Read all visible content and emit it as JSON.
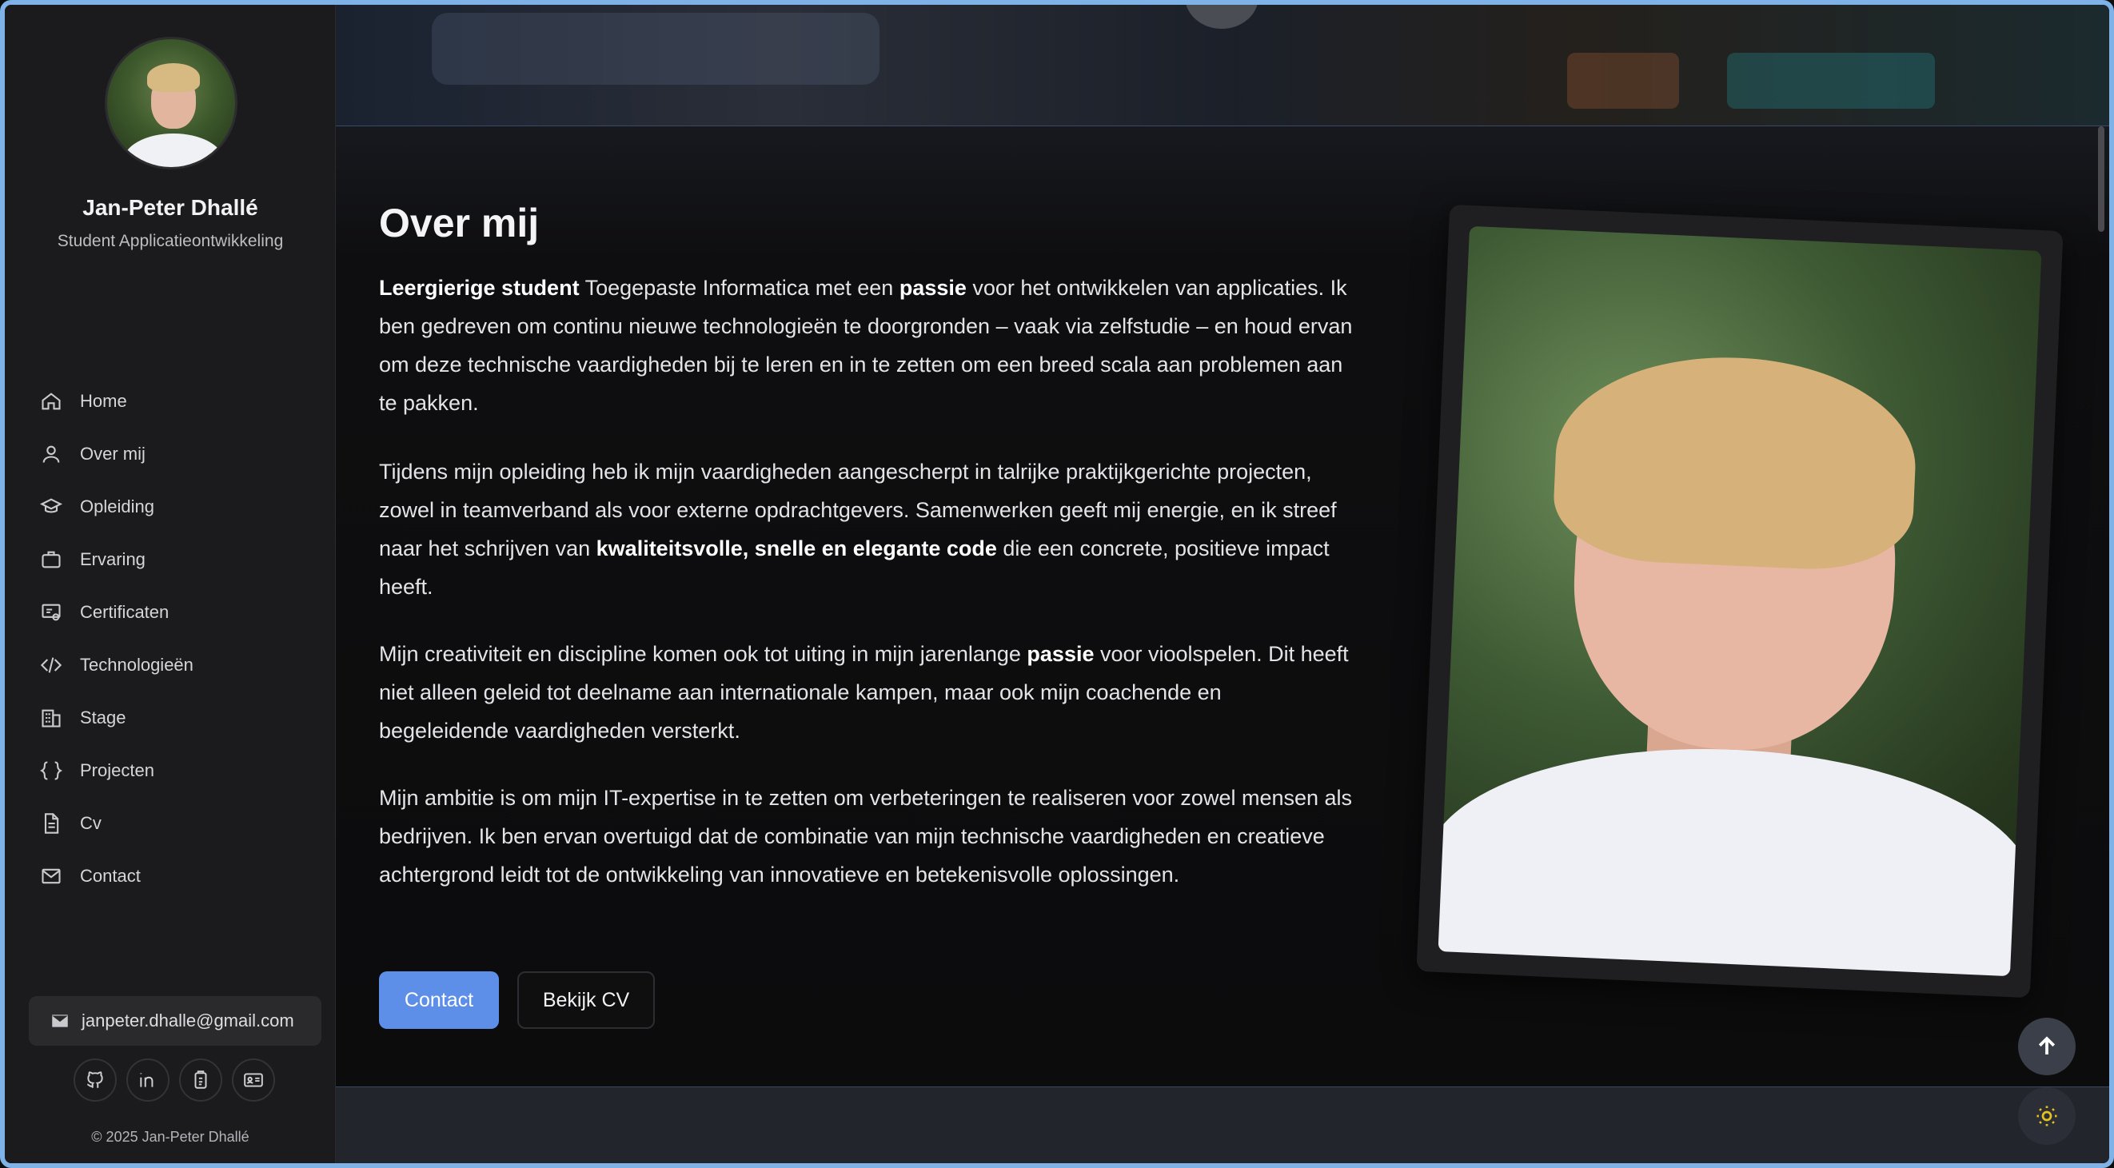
{
  "sidebar": {
    "name": "Jan-Peter Dhallé",
    "role": "Student Applicatieontwikkeling",
    "nav": [
      {
        "label": "Home",
        "icon": "home-icon"
      },
      {
        "label": "Over mij",
        "icon": "user-icon"
      },
      {
        "label": "Opleiding",
        "icon": "graduation-cap-icon"
      },
      {
        "label": "Ervaring",
        "icon": "briefcase-icon"
      },
      {
        "label": "Certificaten",
        "icon": "certificate-icon"
      },
      {
        "label": "Technologieën",
        "icon": "code-icon"
      },
      {
        "label": "Stage",
        "icon": "building-icon"
      },
      {
        "label": "Projecten",
        "icon": "braces-icon"
      },
      {
        "label": "Cv",
        "icon": "document-icon"
      },
      {
        "label": "Contact",
        "icon": "mail-icon"
      }
    ],
    "email": "janpeter.dhalle@gmail.com",
    "socials": [
      "github-icon",
      "linkedin-icon",
      "clipboard-badge-icon",
      "id-card-icon"
    ],
    "copyright": "© 2025 Jan-Peter Dhallé"
  },
  "main": {
    "title": "Over mij",
    "p1": {
      "b1": "Leergierige student",
      "t1": " Toegepaste Informatica met een ",
      "b2": "passie",
      "t2": " voor het ontwikkelen van applicaties. Ik ben gedreven om continu nieuwe technologieën te doorgronden – vaak via zelfstudie – en houd ervan om deze technische vaardigheden bij te leren en in te zetten om een breed scala aan problemen aan te pakken."
    },
    "p2": {
      "t1": "Tijdens mijn opleiding heb ik mijn vaardigheden aangescherpt in talrijke praktijkgerichte projecten, zowel in teamverband als voor externe opdrachtgevers. Samenwerken geeft mij energie, en ik streef naar het schrijven van ",
      "b1": "kwaliteitsvolle, snelle en elegante code",
      "t2": " die een concrete, positieve impact heeft."
    },
    "p3": {
      "t1": "Mijn creativiteit en discipline komen ook tot uiting in mijn jarenlange ",
      "b1": "passie",
      "t2": " voor vioolspelen. Dit heeft niet alleen geleid tot deelname aan internationale kampen, maar ook mijn coachende en begeleidende vaardigheden versterkt."
    },
    "p4": "Mijn ambitie is om mijn IT-expertise in te zetten om verbeteringen te realiseren voor zowel mensen als bedrijven. Ik ben ervan overtuigd dat de combinatie van mijn technische vaardigheden en creatieve achtergrond leidt tot de ontwikkeling van innovatieve en betekenisvolle oplossingen.",
    "contact_button": "Contact",
    "cv_button": "Bekijk CV"
  },
  "colors": {
    "accent": "#5d8fe8",
    "theme_icon": "#e6c21e"
  }
}
